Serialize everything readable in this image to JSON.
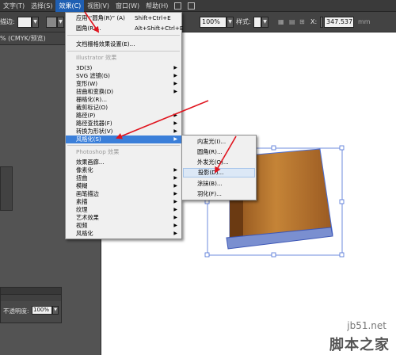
{
  "menubar": {
    "items": [
      "文字(T)",
      "选择(S)",
      "效果(C)",
      "视图(V)",
      "窗口(W)",
      "帮助(H)"
    ],
    "active_index": 2
  },
  "controlbar": {
    "left_label": "描边:",
    "opacity_value": "100%",
    "style_label": "样式:",
    "coord_value": "347.537",
    "coord_label": "X:"
  },
  "document": {
    "tab_title": "% (CMYK/预览)"
  },
  "panel": {
    "opacity_label": "不透明度:",
    "opacity_value": "100%"
  },
  "effect_menu": {
    "apply_last": {
      "label": "应用 “圆角(R)”  (A)",
      "shortcut": "Shift+Ctrl+E"
    },
    "last_effect": {
      "label": "圆角(R)...",
      "shortcut": "Alt+Shift+Ctrl+E"
    },
    "document_raster": "文档栅格效果设置(E)...",
    "illustrator_header": "Illustrator 效果",
    "illustrator_items": [
      "3D(3)",
      "SVG 滤镜(G)",
      "变形(W)",
      "扭曲和变换(D)",
      "栅格化(R)...",
      "裁剪标记(O)",
      "路径(P)",
      "路径查找器(F)",
      "转换为形状(V)",
      "风格化(S)"
    ],
    "photoshop_header": "Photoshop 效果",
    "photoshop_items": [
      "效果画廊...",
      "像素化",
      "扭曲",
      "模糊",
      "画笔描边",
      "素描",
      "纹理",
      "艺术效果",
      "视频",
      "风格化"
    ],
    "highlighted": "风格化(S)"
  },
  "stylize_submenu": {
    "items": [
      "内发光(I)...",
      "圆角(R)...",
      "外发光(O)...",
      "投影(D)...",
      "涂抹(B)...",
      "羽化(F)..."
    ],
    "hovered": "投影(D)..."
  },
  "watermark": {
    "site": "jb51.net",
    "logo": "脚本之家"
  },
  "colors": {
    "menu_highlight": "#3b7fd9",
    "arrow_red": "#e0141e",
    "book_brown": "#b36f2c",
    "selection_blue": "#4a6fd6"
  }
}
